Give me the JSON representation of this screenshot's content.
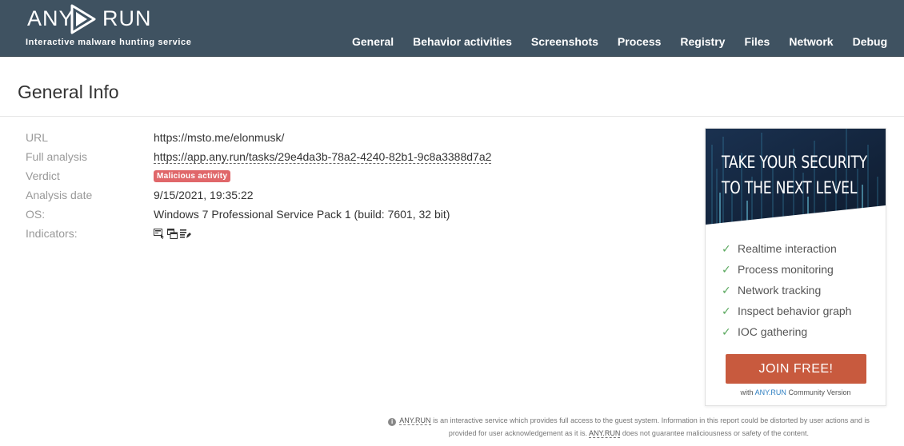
{
  "header": {
    "logo_left": "ANY",
    "logo_right": "RUN",
    "tagline": "Interactive malware hunting service",
    "nav": [
      {
        "label": "General"
      },
      {
        "label": "Behavior activities"
      },
      {
        "label": "Screenshots"
      },
      {
        "label": "Process"
      },
      {
        "label": "Registry"
      },
      {
        "label": "Files"
      },
      {
        "label": "Network"
      },
      {
        "label": "Debug"
      }
    ]
  },
  "page": {
    "title": "General Info"
  },
  "info": {
    "url_label": "URL",
    "url_value": "https://msto.me/elonmusk/",
    "full_label": "Full analysis",
    "full_value": "https://app.any.run/tasks/29e4da3b-78a2-4240-82b1-9c8a3388d7a2",
    "verdict_label": "Verdict",
    "verdict_value": "Malicious activity",
    "date_label": "Analysis date",
    "date_value": "9/15/2021, 19:35:22",
    "os_label": "OS:",
    "os_value": "Windows 7 Professional Service Pack 1 (build: 7601, 32 bit)",
    "indicators_label": "Indicators:",
    "indicator_icons": [
      "screenshot-icon",
      "windows-icon",
      "file-lines-icon"
    ]
  },
  "promo": {
    "headline_line1": "TAKE YOUR SECURITY",
    "headline_line2": "TO THE NEXT LEVEL",
    "features": [
      "Realtime interaction",
      "Process monitoring",
      "Network tracking",
      "Inspect behavior graph",
      "IOC gathering"
    ],
    "check_glyph": "✓",
    "button": "JOIN FREE!",
    "foot_prefix": "with",
    "foot_brand": "ANY.RUN",
    "foot_suffix": "Community Version"
  },
  "footer": {
    "brand": "ANY.RUN",
    "text1": "is an interactive service which provides full access to the guest system. Information in this report could be distorted by user actions and is provided for user acknowledgement as it is.",
    "text2": "does not guarantee maliciousness or safety of the content."
  },
  "colors": {
    "header_bg": "#3f5261",
    "badge_bg": "#e0676a",
    "button_bg": "#c85a3e",
    "check": "#5aa85e",
    "promo_banner": "#15263e"
  }
}
